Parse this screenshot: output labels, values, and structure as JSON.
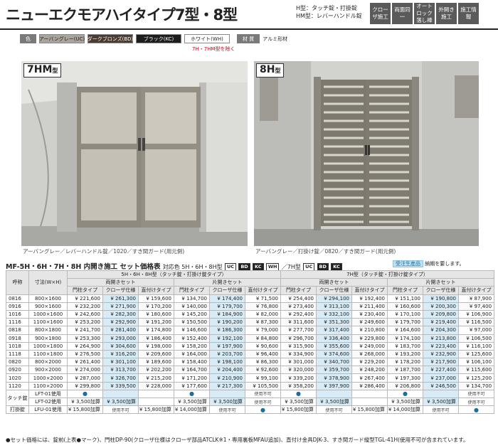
{
  "header": {
    "title": "ニューエクモアハイタイプ7型・8型",
    "lock_notes": [
      "H型：タッチ錠・打掛錠",
      "HM型：レバーハンドル錠"
    ],
    "badges": [
      "クローザ施工",
      "両面同一",
      "オートロック落し棒",
      "外開き施工",
      "施工情報"
    ]
  },
  "colors": {
    "label": "色",
    "options": [
      "アーバングレー(UC)",
      "ダークブロンズ(BD)",
      "ブラック(KC)",
      "ホワイト(WH)"
    ],
    "note": "7H・7HM型を除く",
    "material_label": "材 質",
    "material": "アルミ形材"
  },
  "photos": [
    {
      "tag": "7HM",
      "suffix": "型",
      "caption": "アーバングレー／レバーハンドル錠／1020／すき間ガード(用元側)"
    },
    {
      "tag": "8H",
      "suffix": "型",
      "caption": "アーバングレー／打掛け錠／0820／すき間ガード(用元側)"
    }
  ],
  "section": {
    "title": "MF-5H・6H・7H・8H 内開き施工 セット価格表",
    "applies": "対応色 5H・6H・8H型",
    "applies2": "／7H型",
    "color_codes": [
      "UC",
      "BD",
      "KC",
      "WH"
    ],
    "color_codes2": [
      "UC",
      "BD",
      "KC"
    ],
    "legend_tag": "受注生産品",
    "legend_text": "納期を要します。"
  },
  "table": {
    "group_a": "5H・6H・8H型（タッチ錠・打掛け錠タイプ）",
    "group_b": "7H型（タッチ錠・打掛け錠タイプ）",
    "code_header": "呼称",
    "size_header": "寸法(W×H)",
    "double": "両開きセット",
    "single": "片開きセット",
    "types": [
      "門柱タイプ",
      "クローザ仕様",
      "直付けタイプ"
    ],
    "rows": [
      {
        "code": "0816",
        "size": "800×1600",
        "p": [
          "221,600",
          "261,300",
          "159,600",
          "134,700",
          "174,400",
          "71,500",
          "254,400",
          "294,100",
          "192,400",
          "151,100",
          "190,800",
          "87,900"
        ]
      },
      {
        "code": "0916",
        "size": "900×1600",
        "p": [
          "232,200",
          "271,900",
          "170,200",
          "140,000",
          "179,700",
          "76,800",
          "273,400",
          "313,100",
          "211,400",
          "160,600",
          "200,300",
          "97,400"
        ]
      },
      {
        "code": "1016",
        "size": "1000×1600",
        "p": [
          "242,600",
          "282,300",
          "180,600",
          "145,200",
          "184,900",
          "82,000",
          "292,400",
          "332,100",
          "230,400",
          "170,100",
          "209,800",
          "106,900"
        ]
      },
      {
        "code": "1116",
        "size": "1100×1600",
        "p": [
          "253,200",
          "292,900",
          "191,200",
          "150,500",
          "190,200",
          "87,300",
          "311,600",
          "351,300",
          "249,600",
          "179,700",
          "219,400",
          "116,500"
        ]
      },
      {
        "code": "0818",
        "size": "800×1800",
        "p": [
          "241,700",
          "281,400",
          "174,800",
          "146,600",
          "186,300",
          "79,000",
          "277,700",
          "317,400",
          "210,800",
          "164,600",
          "204,300",
          "97,000"
        ]
      },
      {
        "code": "0918",
        "size": "900×1800",
        "p": [
          "253,300",
          "293,000",
          "186,400",
          "152,400",
          "192,100",
          "84,800",
          "296,700",
          "336,400",
          "229,800",
          "174,100",
          "213,800",
          "106,500"
        ]
      },
      {
        "code": "1018",
        "size": "1000×1800",
        "p": [
          "264,900",
          "304,600",
          "198,000",
          "158,200",
          "197,900",
          "90,600",
          "315,900",
          "355,600",
          "249,000",
          "183,700",
          "223,400",
          "116,100"
        ]
      },
      {
        "code": "1118",
        "size": "1100×1800",
        "p": [
          "276,500",
          "316,200",
          "209,600",
          "164,000",
          "203,700",
          "96,400",
          "334,900",
          "374,600",
          "268,000",
          "193,200",
          "232,900",
          "125,600"
        ]
      },
      {
        "code": "0820",
        "size": "800×2000",
        "p": [
          "261,400",
          "301,100",
          "189,600",
          "158,400",
          "198,100",
          "86,300",
          "301,000",
          "340,700",
          "229,200",
          "178,200",
          "217,900",
          "106,100"
        ]
      },
      {
        "code": "0920",
        "size": "900×2000",
        "p": [
          "274,000",
          "313,700",
          "202,200",
          "164,700",
          "204,400",
          "92,600",
          "320,000",
          "359,700",
          "248,200",
          "187,700",
          "227,400",
          "115,600"
        ]
      },
      {
        "code": "1020",
        "size": "1000×2000",
        "p": [
          "287,000",
          "326,700",
          "215,200",
          "171,200",
          "210,900",
          "99,100",
          "339,200",
          "378,900",
          "267,400",
          "197,300",
          "237,000",
          "125,200"
        ]
      },
      {
        "code": "1120",
        "size": "1100×2000",
        "p": [
          "299,800",
          "339,500",
          "228,000",
          "177,600",
          "217,300",
          "105,500",
          "358,200",
          "397,900",
          "286,400",
          "206,800",
          "246,500",
          "134,700"
        ]
      }
    ],
    "lock_group_touch": "タッチ錠",
    "lock_group_latch": "打掛錠",
    "lock_rows": [
      {
        "code": "LFT-01使用",
        "cells": [
          "●",
          "",
          "",
          "●",
          "",
          "使用不可",
          "●",
          "",
          "",
          "●",
          "",
          "使用不可"
        ]
      },
      {
        "code": "LFT-02使用",
        "cells": [
          "¥ 3,500加算",
          "¥ 3,500加算",
          "",
          "¥ 3,500加算",
          "¥ 3,500加算",
          "使用不可",
          "¥ 3,500加算",
          "¥ 3,500加算",
          "",
          "¥ 3,500加算",
          "¥ 3,500加算",
          "使用不可"
        ]
      },
      {
        "code": "LFU-01使用",
        "cells": [
          "¥ 15,800加算",
          "使用不可",
          "¥ 15,800加算",
          "¥ 14,000加算",
          "使用不可",
          "●",
          "¥ 15,800加算",
          "使用不可",
          "¥ 15,800加算",
          "¥ 14,000加算",
          "使用不可",
          "●"
        ]
      }
    ]
  },
  "footnote": "●セット価格には、錠前(上表●マーク)、門柱DP-90(クローザ仕様はクローザ部品ATCLK※1・専用裏板MFAU追加)、直付け金具DJK-3、すき間ガード縦型TGL-41H(使用不可が含まれています。"
}
